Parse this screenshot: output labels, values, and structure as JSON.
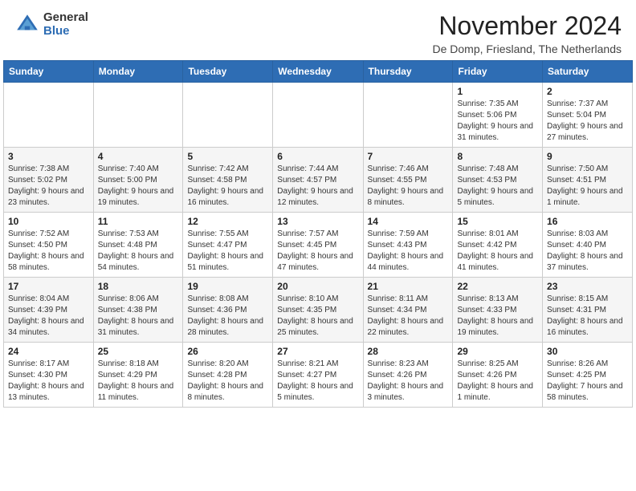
{
  "header": {
    "logo_general": "General",
    "logo_blue": "Blue",
    "title": "November 2024",
    "location": "De Domp, Friesland, The Netherlands"
  },
  "weekdays": [
    "Sunday",
    "Monday",
    "Tuesday",
    "Wednesday",
    "Thursday",
    "Friday",
    "Saturday"
  ],
  "weeks": [
    [
      {
        "day": "",
        "detail": ""
      },
      {
        "day": "",
        "detail": ""
      },
      {
        "day": "",
        "detail": ""
      },
      {
        "day": "",
        "detail": ""
      },
      {
        "day": "",
        "detail": ""
      },
      {
        "day": "1",
        "detail": "Sunrise: 7:35 AM\nSunset: 5:06 PM\nDaylight: 9 hours and 31 minutes."
      },
      {
        "day": "2",
        "detail": "Sunrise: 7:37 AM\nSunset: 5:04 PM\nDaylight: 9 hours and 27 minutes."
      }
    ],
    [
      {
        "day": "3",
        "detail": "Sunrise: 7:38 AM\nSunset: 5:02 PM\nDaylight: 9 hours and 23 minutes."
      },
      {
        "day": "4",
        "detail": "Sunrise: 7:40 AM\nSunset: 5:00 PM\nDaylight: 9 hours and 19 minutes."
      },
      {
        "day": "5",
        "detail": "Sunrise: 7:42 AM\nSunset: 4:58 PM\nDaylight: 9 hours and 16 minutes."
      },
      {
        "day": "6",
        "detail": "Sunrise: 7:44 AM\nSunset: 4:57 PM\nDaylight: 9 hours and 12 minutes."
      },
      {
        "day": "7",
        "detail": "Sunrise: 7:46 AM\nSunset: 4:55 PM\nDaylight: 9 hours and 8 minutes."
      },
      {
        "day": "8",
        "detail": "Sunrise: 7:48 AM\nSunset: 4:53 PM\nDaylight: 9 hours and 5 minutes."
      },
      {
        "day": "9",
        "detail": "Sunrise: 7:50 AM\nSunset: 4:51 PM\nDaylight: 9 hours and 1 minute."
      }
    ],
    [
      {
        "day": "10",
        "detail": "Sunrise: 7:52 AM\nSunset: 4:50 PM\nDaylight: 8 hours and 58 minutes."
      },
      {
        "day": "11",
        "detail": "Sunrise: 7:53 AM\nSunset: 4:48 PM\nDaylight: 8 hours and 54 minutes."
      },
      {
        "day": "12",
        "detail": "Sunrise: 7:55 AM\nSunset: 4:47 PM\nDaylight: 8 hours and 51 minutes."
      },
      {
        "day": "13",
        "detail": "Sunrise: 7:57 AM\nSunset: 4:45 PM\nDaylight: 8 hours and 47 minutes."
      },
      {
        "day": "14",
        "detail": "Sunrise: 7:59 AM\nSunset: 4:43 PM\nDaylight: 8 hours and 44 minutes."
      },
      {
        "day": "15",
        "detail": "Sunrise: 8:01 AM\nSunset: 4:42 PM\nDaylight: 8 hours and 41 minutes."
      },
      {
        "day": "16",
        "detail": "Sunrise: 8:03 AM\nSunset: 4:40 PM\nDaylight: 8 hours and 37 minutes."
      }
    ],
    [
      {
        "day": "17",
        "detail": "Sunrise: 8:04 AM\nSunset: 4:39 PM\nDaylight: 8 hours and 34 minutes."
      },
      {
        "day": "18",
        "detail": "Sunrise: 8:06 AM\nSunset: 4:38 PM\nDaylight: 8 hours and 31 minutes."
      },
      {
        "day": "19",
        "detail": "Sunrise: 8:08 AM\nSunset: 4:36 PM\nDaylight: 8 hours and 28 minutes."
      },
      {
        "day": "20",
        "detail": "Sunrise: 8:10 AM\nSunset: 4:35 PM\nDaylight: 8 hours and 25 minutes."
      },
      {
        "day": "21",
        "detail": "Sunrise: 8:11 AM\nSunset: 4:34 PM\nDaylight: 8 hours and 22 minutes."
      },
      {
        "day": "22",
        "detail": "Sunrise: 8:13 AM\nSunset: 4:33 PM\nDaylight: 8 hours and 19 minutes."
      },
      {
        "day": "23",
        "detail": "Sunrise: 8:15 AM\nSunset: 4:31 PM\nDaylight: 8 hours and 16 minutes."
      }
    ],
    [
      {
        "day": "24",
        "detail": "Sunrise: 8:17 AM\nSunset: 4:30 PM\nDaylight: 8 hours and 13 minutes."
      },
      {
        "day": "25",
        "detail": "Sunrise: 8:18 AM\nSunset: 4:29 PM\nDaylight: 8 hours and 11 minutes."
      },
      {
        "day": "26",
        "detail": "Sunrise: 8:20 AM\nSunset: 4:28 PM\nDaylight: 8 hours and 8 minutes."
      },
      {
        "day": "27",
        "detail": "Sunrise: 8:21 AM\nSunset: 4:27 PM\nDaylight: 8 hours and 5 minutes."
      },
      {
        "day": "28",
        "detail": "Sunrise: 8:23 AM\nSunset: 4:26 PM\nDaylight: 8 hours and 3 minutes."
      },
      {
        "day": "29",
        "detail": "Sunrise: 8:25 AM\nSunset: 4:26 PM\nDaylight: 8 hours and 1 minute."
      },
      {
        "day": "30",
        "detail": "Sunrise: 8:26 AM\nSunset: 4:25 PM\nDaylight: 7 hours and 58 minutes."
      }
    ]
  ]
}
